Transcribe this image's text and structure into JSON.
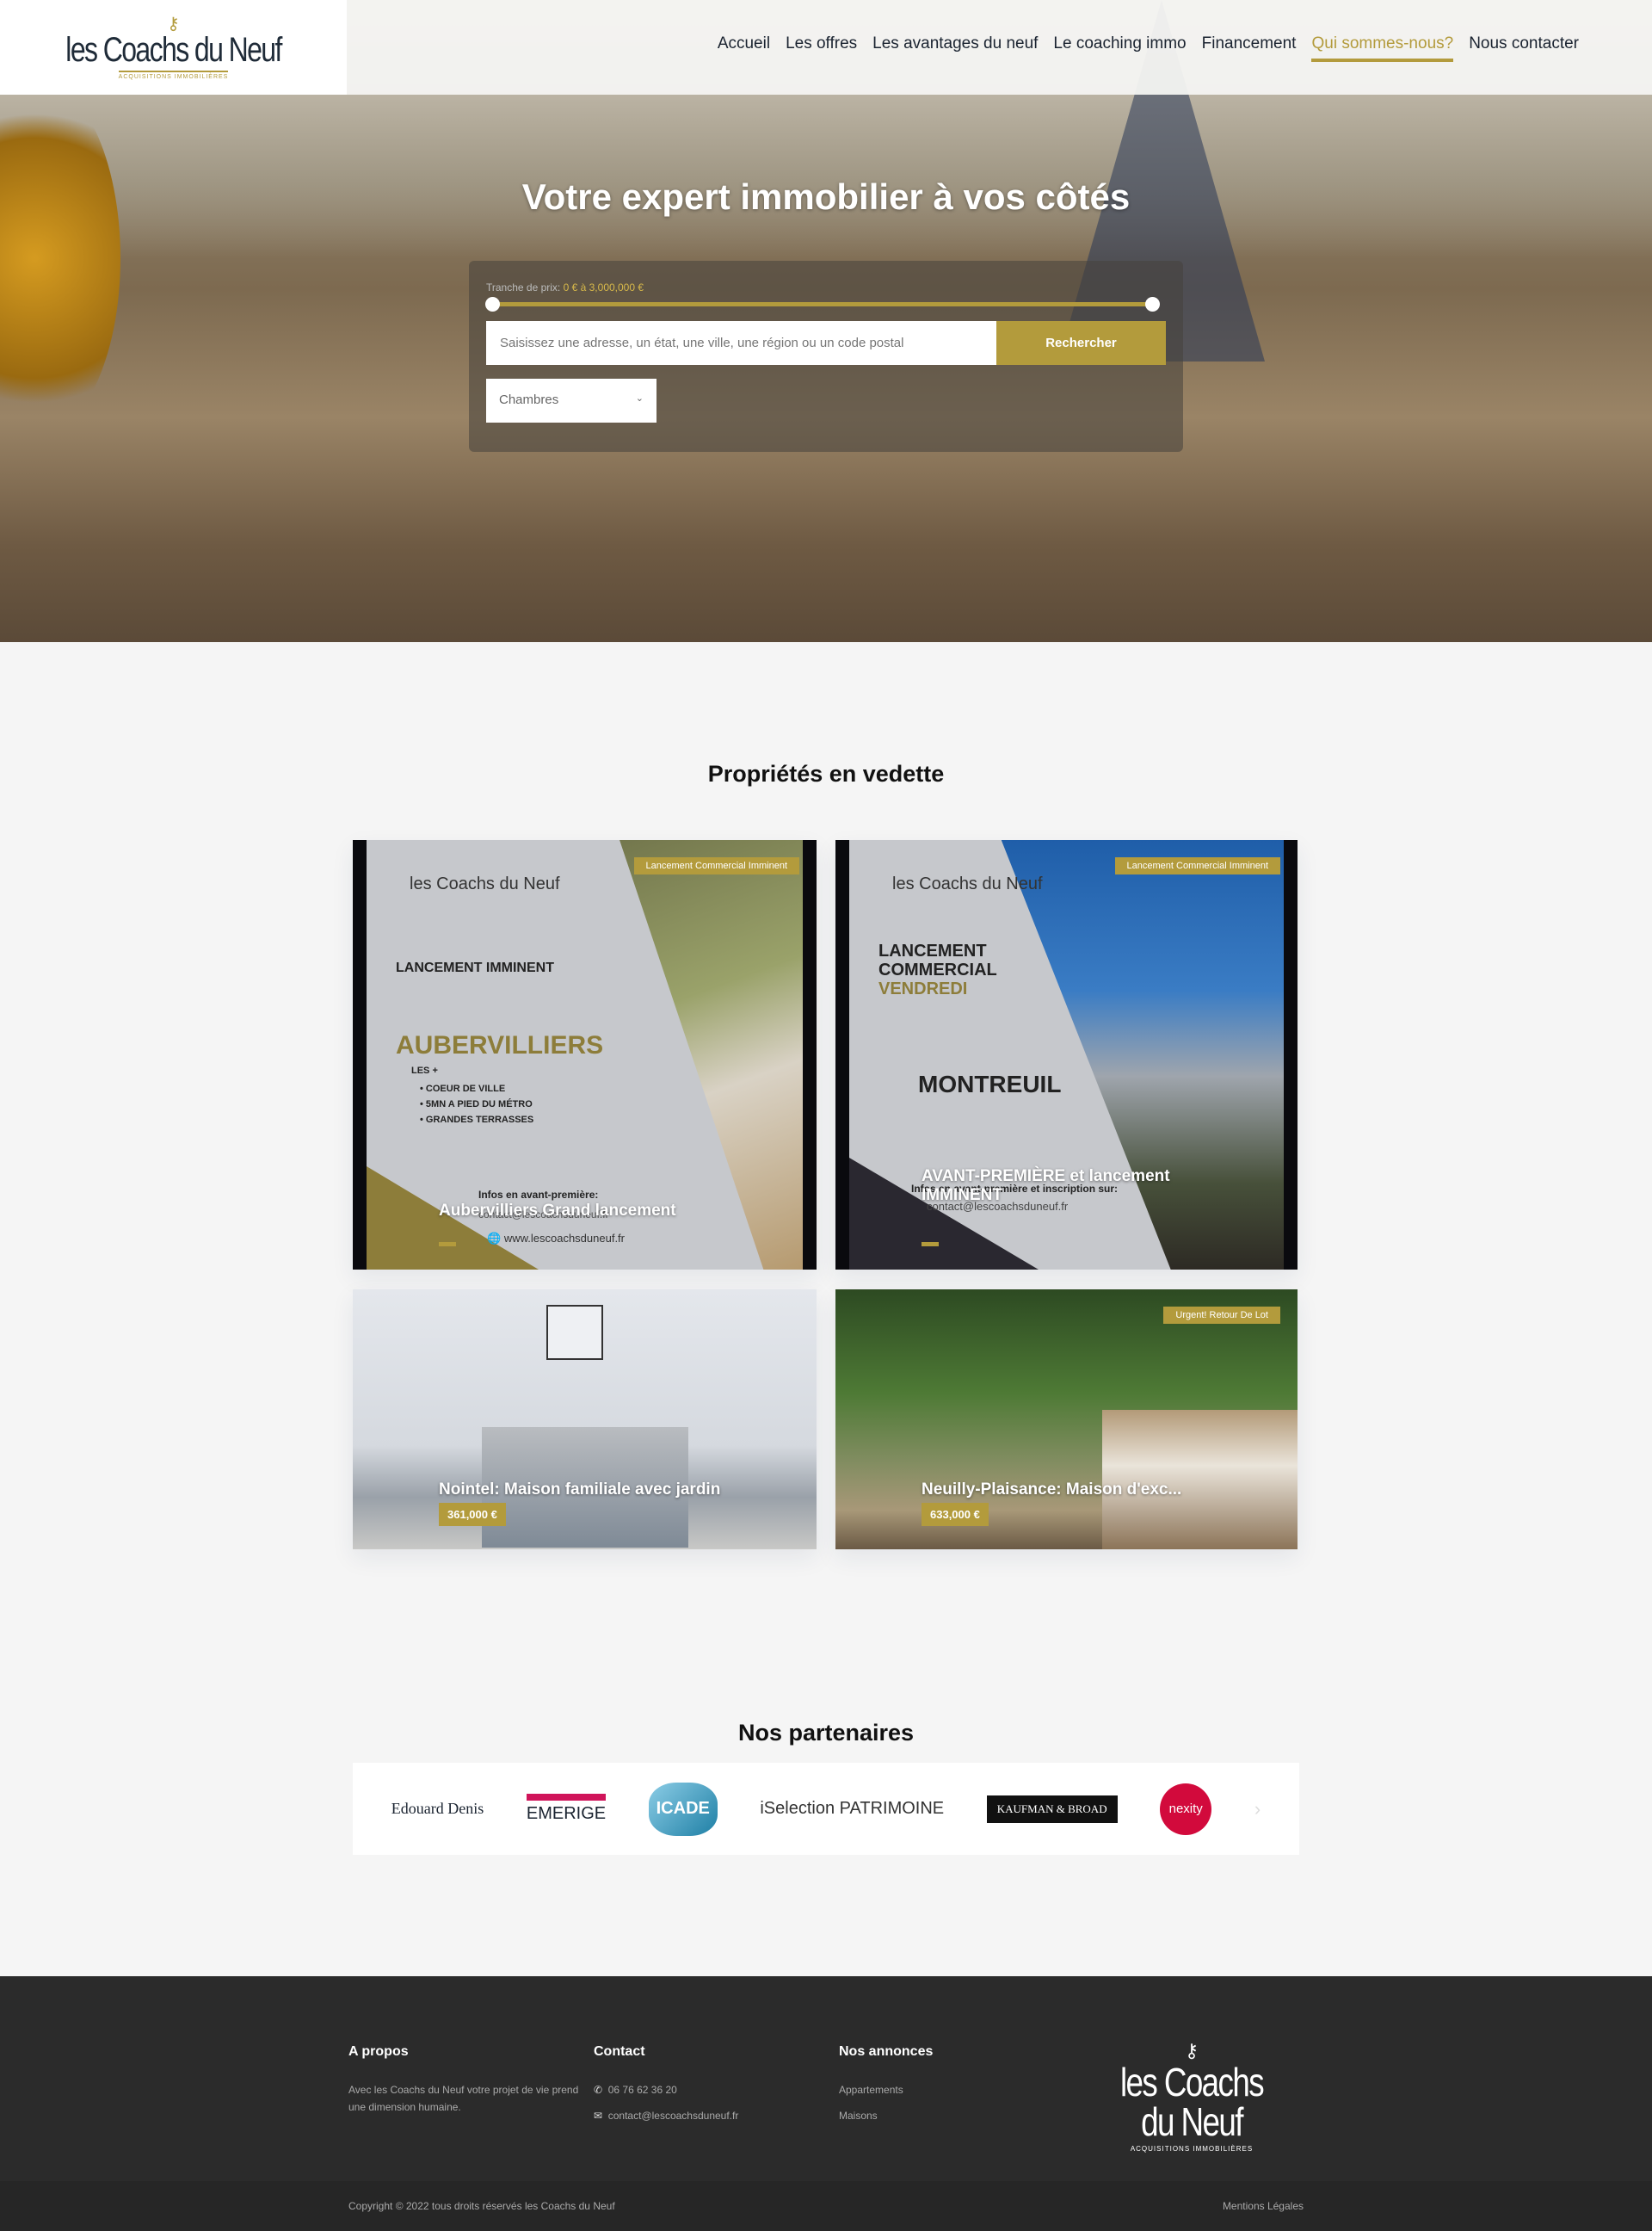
{
  "header": {
    "logo_text": "les Coachs du Neuf",
    "logo_sub": "ACQUISITIONS IMMOBILIÈRES",
    "nav": [
      {
        "label": "Accueil"
      },
      {
        "label": "Les offres"
      },
      {
        "label": "Les avantages du neuf"
      },
      {
        "label": "Le coaching immo"
      },
      {
        "label": "Financement"
      },
      {
        "label": "Qui sommes-nous?",
        "active": true
      },
      {
        "label": "Nous contacter"
      }
    ]
  },
  "hero": {
    "title": "Votre expert immobilier à vos côtés",
    "search": {
      "price_label": "Tranche de prix:",
      "price_range": "0 € à 3,000,000 €",
      "price_min": 0,
      "price_max": 3000000,
      "placeholder": "Saisissez une adresse, un état, une ville, une région ou un code postal",
      "button": "Rechercher",
      "bedrooms": "Chambres"
    }
  },
  "featured": {
    "title": "Propriétés en vedette",
    "cards": [
      {
        "title": "Aubervilliers Grand lancement",
        "badge": "Lancement Commercial Imminent",
        "poster": {
          "logo": "les Coachs du Neuf",
          "line1": "LANCEMENT IMMINENT",
          "city": "AUBERVILLIERS",
          "plus": "LES +",
          "bullets": [
            "COEUR DE VILLE",
            "5MN A PIED DU MÉTRO",
            "GRANDES TERRASSES"
          ],
          "info": "Infos en avant-première:",
          "contact": "contact@lescoachsduneuf.fr",
          "web": "www.lescoachsduneuf.fr"
        }
      },
      {
        "title": "AVANT-PREMIÈRE et lancement IMMINENT",
        "badge": "Lancement Commercial Imminent",
        "poster": {
          "logo": "les Coachs du Neuf",
          "line1": "LANCEMENT",
          "line2": "COMMERCIAL",
          "line3": "VENDREDI",
          "city": "MONTREUIL",
          "info": "Infos en avant-première et inscription sur:",
          "contact": "contact@lescoachsduneuf.fr"
        }
      },
      {
        "title": "Nointel: Maison familiale avec jardin",
        "price": "361,000 €"
      },
      {
        "title": "Neuilly-Plaisance: Maison d'exc...",
        "price": "633,000 €",
        "badge": "Urgent! Retour De Lot"
      }
    ]
  },
  "partners": {
    "title": "Nos partenaires",
    "logos": [
      "Edouard Denis",
      "EMERIGE",
      "ICADE",
      "iSelection PATRIMOINE",
      "KAUFMAN & BROAD",
      "nexity"
    ]
  },
  "footer": {
    "about": {
      "title": "A propos",
      "text": "Avec les Coachs du Neuf votre projet de vie prend une dimension humaine."
    },
    "contact": {
      "title": "Contact",
      "phone": "06 76 62 36 20",
      "email": "contact@lescoachsduneuf.fr"
    },
    "listings": {
      "title": "Nos annonces",
      "items": [
        "Appartements",
        "Maisons"
      ]
    },
    "logo_text": "les Coachs du Neuf",
    "logo_sub": "ACQUISITIONS IMMOBILIÈRES",
    "copyright": "Copyright © 2022 tous droits réservés les Coachs du Neuf",
    "legal": "Mentions Légales"
  },
  "colors": {
    "accent": "#b39b3c",
    "footer": "#2b2b2b",
    "text": "#1a2330"
  }
}
